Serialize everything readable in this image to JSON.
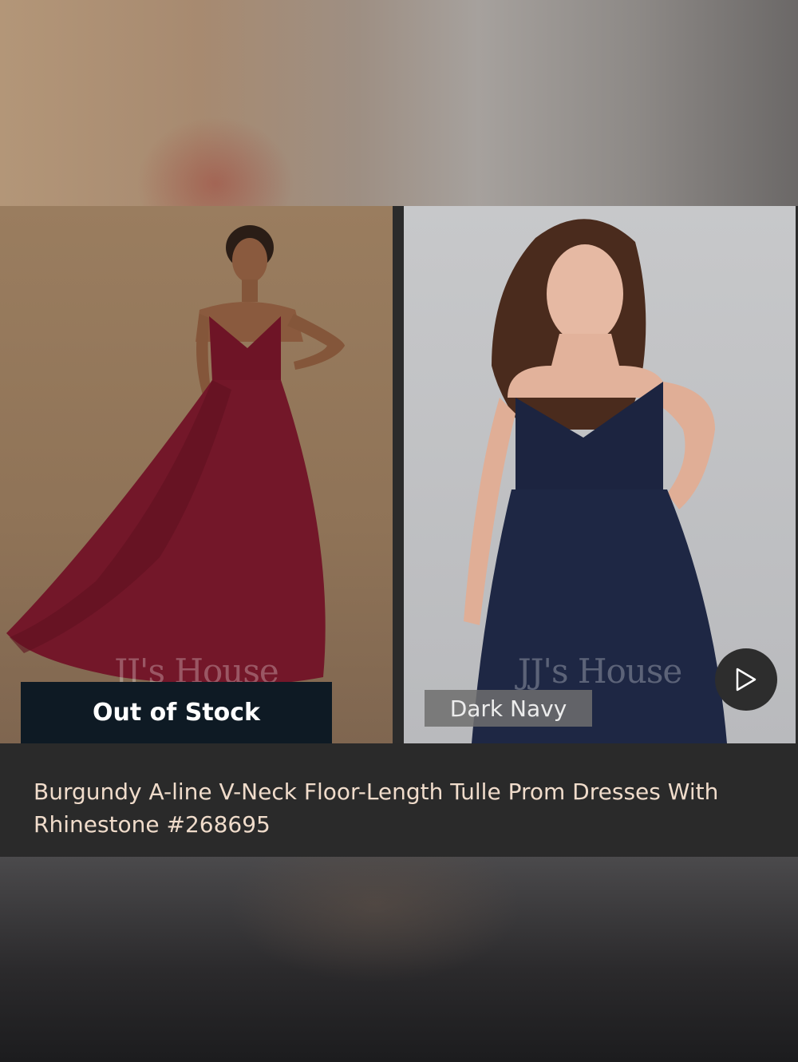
{
  "product": {
    "title": "Burgundy A-line V-Neck Floor-Length Tulle Prom Dresses With Rhinestone #268695",
    "stock_status": "Out of Stock"
  },
  "images": {
    "left": {
      "watermark": "JJ's House",
      "dress_color": "#6e1426"
    },
    "right": {
      "watermark": "JJ's House",
      "color_label": "Dark Navy",
      "dress_color": "#1c2440"
    }
  },
  "controls": {
    "play_icon": "play-icon"
  },
  "colors": {
    "title_text": "#f0dccb",
    "out_of_stock_bg": "#0e1a24",
    "panel_bg": "#2a2a2a"
  }
}
